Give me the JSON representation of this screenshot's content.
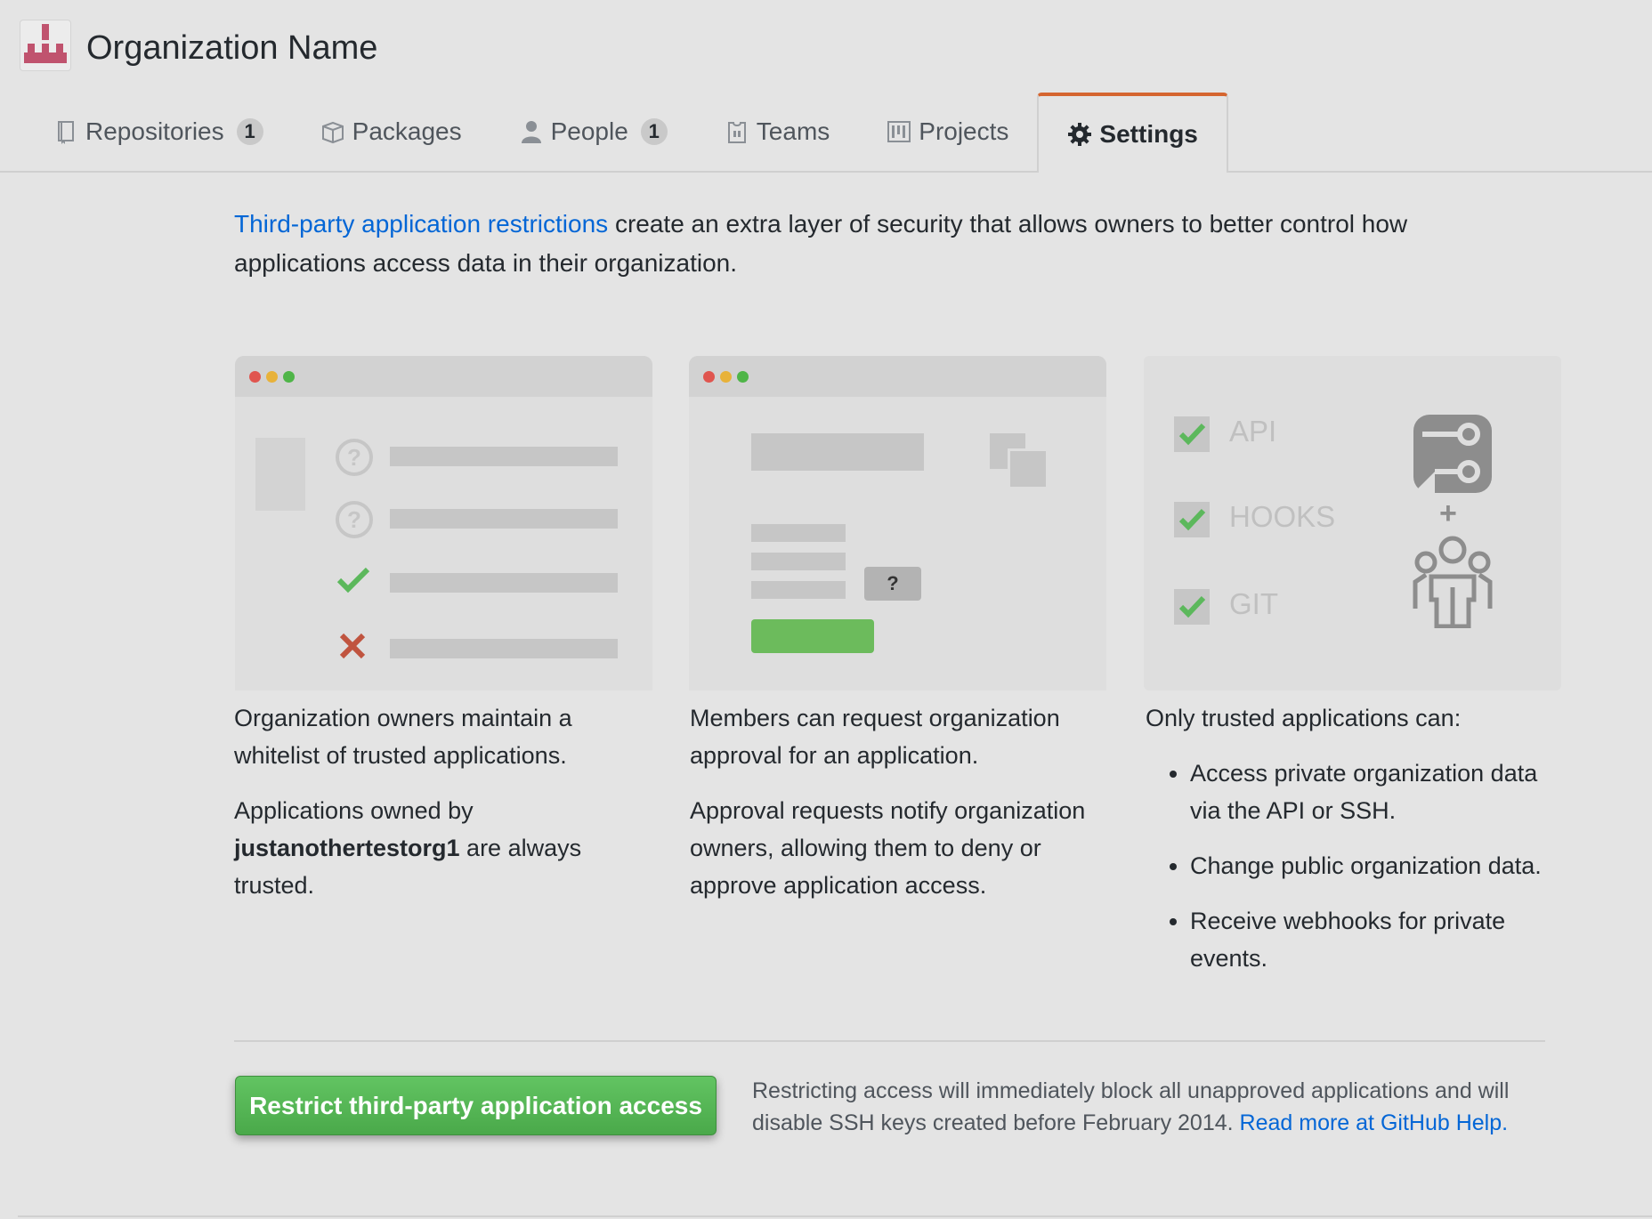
{
  "header": {
    "org_name": "Organization Name",
    "tabs": [
      {
        "label": "Repositories",
        "count": "1",
        "icon": "repo-icon"
      },
      {
        "label": "Packages",
        "icon": "package-icon"
      },
      {
        "label": "People",
        "count": "1",
        "icon": "person-icon"
      },
      {
        "label": "Teams",
        "icon": "jersey-icon"
      },
      {
        "label": "Projects",
        "icon": "project-icon"
      },
      {
        "label": "Settings",
        "icon": "gear-icon",
        "selected": true
      }
    ]
  },
  "intro": {
    "link_text": "Third-party application restrictions",
    "text": " create an extra layer of security that allows owners to better control how applications access data in their organization."
  },
  "columns": [
    {
      "p1": "Organization owners maintain a whitelist of trusted applications.",
      "p2_before": "Applications owned by ",
      "p2_bold": "justanothertestorg1",
      "p2_after": " are always trusted."
    },
    {
      "p1": "Members can request organization approval for an application.",
      "p2": "Approval requests notify organization owners, allowing them to deny or approve application access."
    },
    {
      "p1": "Only trusted applications can:",
      "items": [
        "Access private organization data via the API or SSH.",
        "Change public organization data.",
        "Receive webhooks for private events."
      ]
    }
  ],
  "illustration": {
    "checks": [
      "API",
      "HOOKS",
      "GIT"
    ],
    "question_mark": "?",
    "plus": "+"
  },
  "footer": {
    "button_label": "Restrict third-party application access",
    "note": "Restricting access will immediately block all unapproved applications and will disable SSH keys created before February 2014. ",
    "help_link": "Read more at GitHub Help."
  },
  "colors": {
    "link": "#0366d6",
    "accent_tab": "#d5652f",
    "button_green": "#4aa94a",
    "check_green": "#5cb85c",
    "cross_red": "#c0543f"
  }
}
